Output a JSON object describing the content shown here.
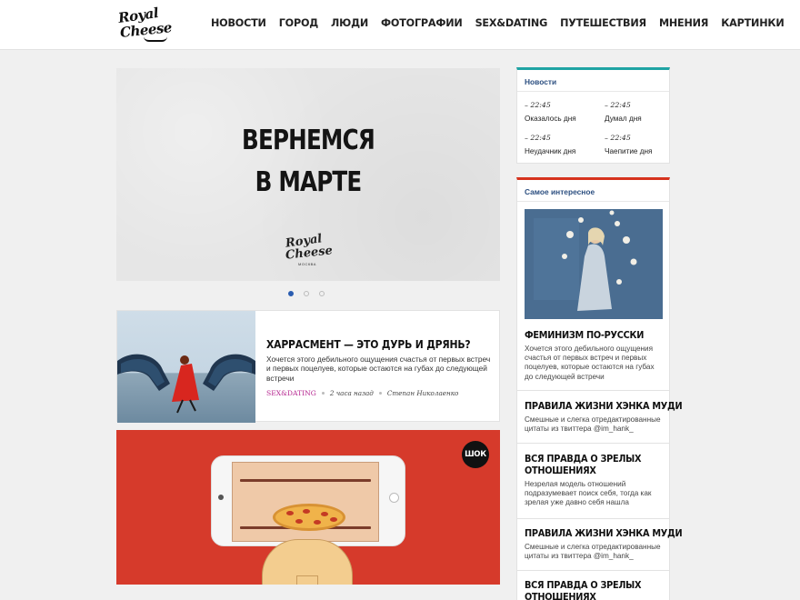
{
  "header": {
    "logo_line1": "Royal",
    "logo_line2": "Cheese",
    "nav": [
      "НОВОСТИ",
      "ГОРОД",
      "ЛЮДИ",
      "ФОТОГРАФИИ",
      "SEX&DATING",
      "ПУТЕШЕСТВИЯ",
      "МНЕНИЯ",
      "КАРТИНКИ"
    ]
  },
  "hero": {
    "line1": "ВЕРНЕМСЯ",
    "line2": "В МАРТЕ",
    "logo_line1": "Royal",
    "logo_line2": "Cheese",
    "logo_sub": "МОСКВА",
    "slides": 3,
    "active_slide": 1
  },
  "article": {
    "title": "ХАРРАСМЕНТ — ЭТО ДУРЬ И ДРЯНЬ?",
    "text": "Хочется этого дебильного ощущения счастья от первых встреч и первых поцелуев, которые остаются на губах до следующей встречи",
    "category": "SEX&DATING",
    "time": "2 часа назад",
    "author": "Степан Николаенко"
  },
  "feature": {
    "badge": "ШОК"
  },
  "sidebar": {
    "news": {
      "heading": "Новости",
      "items": [
        {
          "time": "– 22:45",
          "title": "Оказалось дня"
        },
        {
          "time": "– 22:45",
          "title": "Думал дня"
        },
        {
          "time": "– 22:45",
          "title": "Неудачник дня"
        },
        {
          "time": "– 22:45",
          "title": "Чаепитие дня"
        }
      ]
    },
    "interesting": {
      "heading": "Самое интересное",
      "items": [
        {
          "title": "ФЕМИНИЗМ ПО-РУССКИ",
          "desc": "Хочется этого дебильного ощущения счастья от первых встреч и первых поцелуев, которые остаются на губах до следующей встречи"
        },
        {
          "title": "ПРАВИЛА ЖИЗНИ ХЭНКА МУДИ",
          "desc": "Смешные и слегка отредактированные цитаты из твиттера @im_hank_"
        },
        {
          "title": "ВСЯ ПРАВДА О ЗРЕЛЫХ",
          "title2": "ОТНОШЕНИЯХ",
          "desc": "Незрелая модель отношений подразумевает поиск себя, тогда как зрелая уже давно себя нашла"
        },
        {
          "title": "ПРАВИЛА ЖИЗНИ ХЭНКА МУДИ",
          "desc": "Смешные и слегка отредактированные цитаты из твиттера @im_hank_"
        },
        {
          "title": "ВСЯ ПРАВДА О ЗРЕЛЫХ",
          "title2": "ОТНОШЕНИЯХ"
        }
      ]
    }
  },
  "colors": {
    "news_accent": "#1fa3a3",
    "interesting_accent": "#d6331e",
    "category": "#b5248f",
    "feature_bg": "#d63a2b"
  }
}
